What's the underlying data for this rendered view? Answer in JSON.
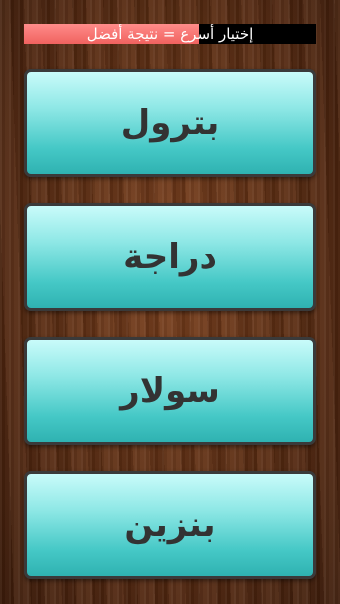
{
  "timer": {
    "text": "إختيار أسرع = نتيجة أفضل",
    "progress_fraction": 0.6,
    "fill_color": "#f0625f",
    "track_color": "#000000"
  },
  "answers": [
    {
      "label": "بترول"
    },
    {
      "label": "دراجة"
    },
    {
      "label": "سولار"
    },
    {
      "label": "بنزين"
    }
  ],
  "colors": {
    "button_top": "#c9fbfa",
    "button_bottom": "#2fb2b1",
    "button_text": "#333333",
    "background": "#5a2c12"
  }
}
